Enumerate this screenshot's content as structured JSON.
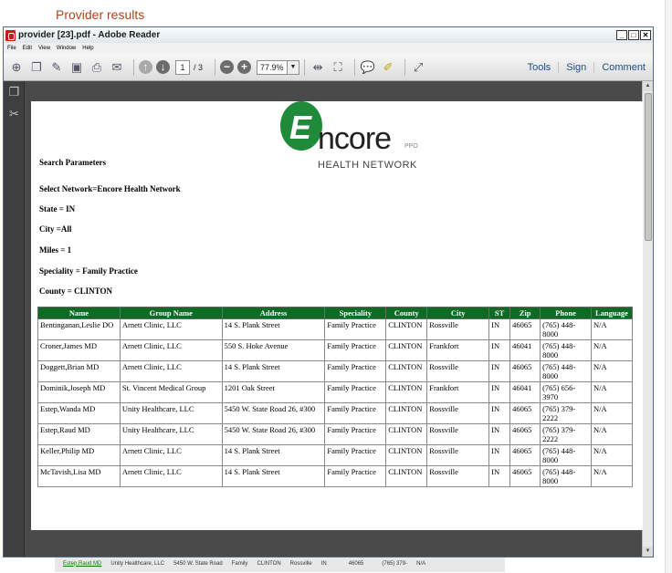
{
  "background": {
    "title": "Provider results",
    "row": {
      "name": "Estep,Raud MD",
      "group": "Unity Healthcare, LLC",
      "address": "5450 W. State Road",
      "speciality": "Family",
      "county": "CLINTON",
      "city": "Rossville",
      "state": "IN",
      "zip": "46065",
      "phone": "(765) 379-",
      "language": "N/A"
    }
  },
  "window": {
    "title": "provider [23].pdf - Adobe Reader",
    "controls": {
      "minimize": "_",
      "maximize": "□",
      "close": "✕"
    }
  },
  "menu": [
    "File",
    "Edit",
    "View",
    "Window",
    "Help"
  ],
  "toolbar": {
    "page_current": "1",
    "page_total": "/ 3",
    "zoom": "77.9%",
    "tools_label": "Tools",
    "sign_label": "Sign",
    "comment_label": "Comment"
  },
  "logo": {
    "letter": "E",
    "word": "ncore",
    "ppo": "PPO",
    "network": "HEALTH NETWORK"
  },
  "document": {
    "params": [
      "Search Parameters",
      "Select Network=Encore Health Network",
      "State = IN",
      "City =All",
      "Miles = 1",
      "Speciality = Family Practice",
      "County = CLINTON"
    ],
    "columns": [
      "Name",
      "Group Name",
      "Address",
      "Speciality",
      "County",
      "City",
      "ST",
      "Zip",
      "Phone",
      "Language"
    ],
    "rows": [
      [
        "Bentinganan,Leslie DO",
        "Arnett Clinic, LLC",
        "14 S. Plank Street",
        "Family Practice",
        "CLINTON",
        "Rossville",
        "IN",
        "46065",
        "(765) 448-8000",
        "N/A"
      ],
      [
        "Croner,James MD",
        "Arnett Clinic, LLC",
        "550 S. Hoke Avenue",
        "Family Practice",
        "CLINTON",
        "Frankfort",
        "IN",
        "46041",
        "(765) 448-8000",
        "N/A"
      ],
      [
        "Doggett,Brian MD",
        "Arnett Clinic, LLC",
        "14 S. Plank Street",
        "Family Practice",
        "CLINTON",
        "Rossville",
        "IN",
        "46065",
        "(765) 448-8000",
        "N/A"
      ],
      [
        "Dominik,Joseph MD",
        "St. Vincent Medical Group",
        "1201 Oak Street",
        "Family Practice",
        "CLINTON",
        "Frankfort",
        "IN",
        "46041",
        "(765) 656-3970",
        "N/A"
      ],
      [
        "Estep,Wanda MD",
        "Unity Healthcare, LLC",
        "5450 W. State Road 26, #300",
        "Family Practice",
        "CLINTON",
        "Rossville",
        "IN",
        "46065",
        "(765) 379-2222",
        "N/A"
      ],
      [
        "Estep,Raud MD",
        "Unity Healthcare, LLC",
        "5450 W. State Road 26, #300",
        "Family Practice",
        "CLINTON",
        "Rossville",
        "IN",
        "46065",
        "(765) 379-2222",
        "N/A"
      ],
      [
        "Keller,Philip MD",
        "Arnett Clinic, LLC",
        "14 S. Plank Street",
        "Family Practice",
        "CLINTON",
        "Rossville",
        "IN",
        "46065",
        "(765) 448-8000",
        "N/A"
      ],
      [
        "McTavish,Lisa MD",
        "Arnett Clinic, LLC",
        "14 S. Plank Street",
        "Family Practice",
        "CLINTON",
        "Rossville",
        "IN",
        "46065",
        "(765) 448-8000",
        "N/A"
      ]
    ]
  },
  "icons": [
    "open-icon",
    "create-pdf-icon",
    "edit-icon",
    "save-icon",
    "print-icon",
    "email-icon",
    "prev-page-icon",
    "next-page-icon",
    "zoom-out-icon",
    "zoom-in-icon",
    "fit-width-icon",
    "fit-page-icon",
    "comment-icon",
    "highlight-icon",
    "fullscreen-icon",
    "pages-icon",
    "attachment-icon"
  ]
}
